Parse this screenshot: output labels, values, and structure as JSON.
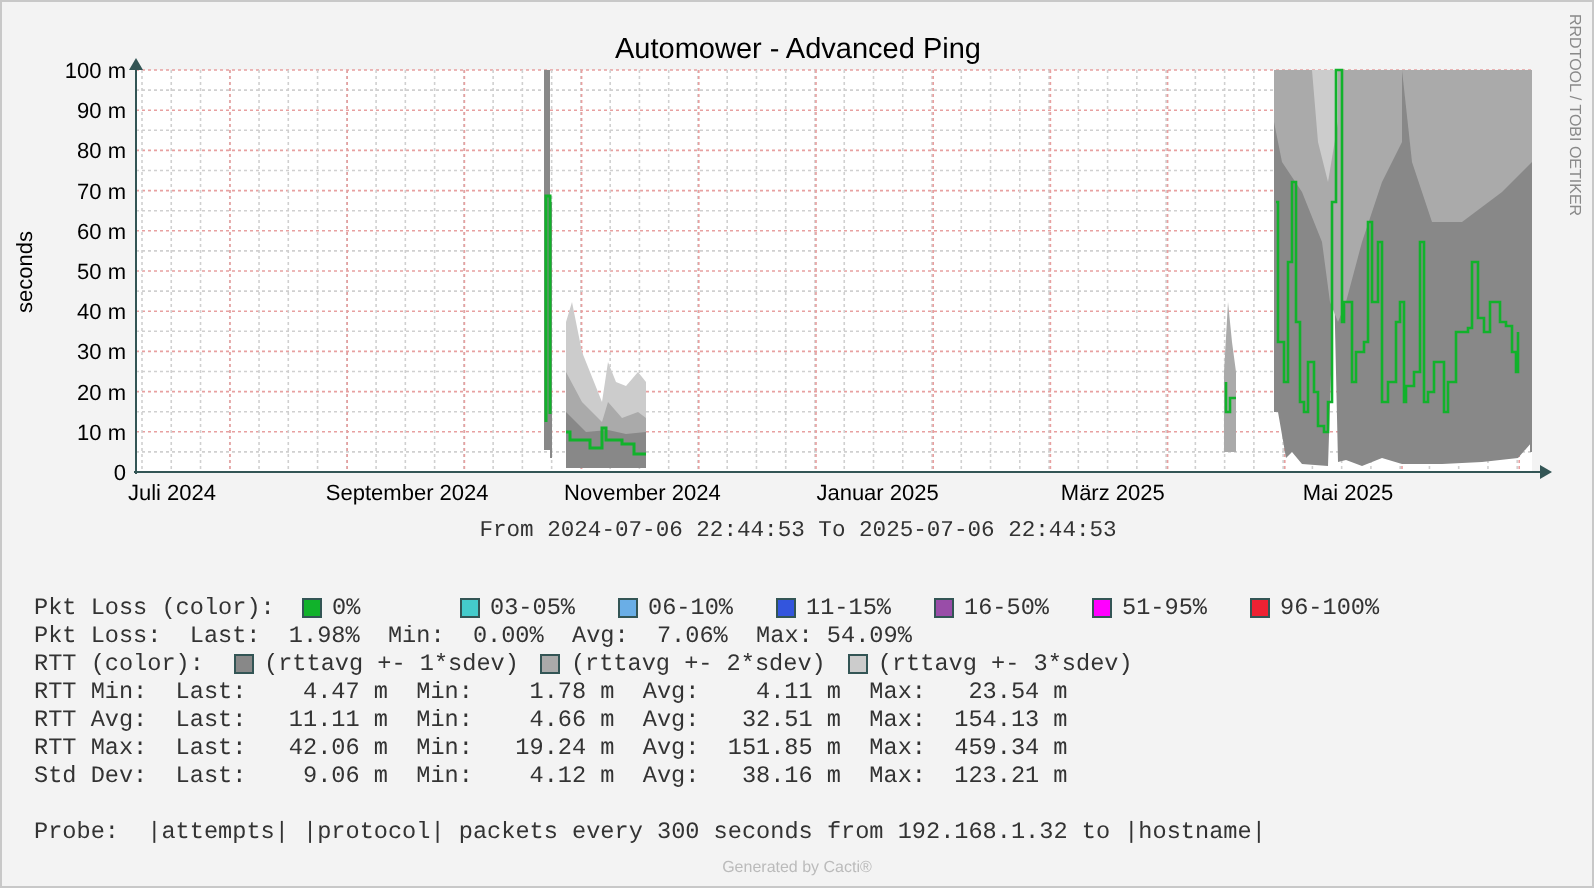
{
  "graph": {
    "title": "Automower - Advanced Ping",
    "ylabel": "seconds",
    "yticks": [
      "100 m",
      "90 m",
      "80 m",
      "70 m",
      "60 m",
      "50 m",
      "40 m",
      "30 m",
      "20 m",
      "10 m",
      "0"
    ],
    "xticks": [
      "Juli 2024",
      "September 2024",
      "November 2024",
      "Januar 2025",
      "März 2025",
      "Mai 2025"
    ],
    "range": "From 2024-07-06 22:44:53 To 2025-07-06 22:44:53",
    "side_text": "RRDTOOL / TOBI OETIKER"
  },
  "loss_legend": {
    "label": "Pkt Loss (color):",
    "items": [
      {
        "label": "0%",
        "color": "#11b22b"
      },
      {
        "label": "03-05%",
        "color": "#44cccc"
      },
      {
        "label": "06-10%",
        "color": "#6aaee6"
      },
      {
        "label": "11-15%",
        "color": "#3355dd"
      },
      {
        "label": "16-50%",
        "color": "#994da8"
      },
      {
        "label": "51-95%",
        "color": "#ff00ff"
      },
      {
        "label": "96-100%",
        "color": "#ee2233"
      }
    ]
  },
  "stats": [
    {
      "kind": "loss",
      "label": "Pkt Loss:",
      "cells": [
        "Last:",
        "1.98%",
        "Min:",
        "0.00%",
        "Avg:",
        "7.06%",
        "Max:",
        "54.09%"
      ]
    }
  ],
  "rtt_legend": {
    "label": "RTT (color):",
    "items": [
      {
        "label": "(rttavg +- 1*sdev)",
        "color": "#888888"
      },
      {
        "label": "(rttavg +- 2*sdev)",
        "color": "#aaaaaa"
      },
      {
        "label": "(rttavg +- 3*sdev)",
        "color": "#cccccc"
      }
    ]
  },
  "rtt_stats": [
    {
      "kind": "rtt",
      "label": "RTT Min:",
      "cells": [
        "Last:",
        "4.47 m",
        "Min:",
        "1.78 m",
        "Avg:",
        "4.11 m",
        "Max:",
        "23.54 m"
      ]
    },
    {
      "kind": "rtt",
      "label": "RTT Avg:",
      "cells": [
        "Last:",
        "11.11 m",
        "Min:",
        "4.66 m",
        "Avg:",
        "32.51 m",
        "Max:",
        "154.13 m"
      ]
    },
    {
      "kind": "rtt",
      "label": "RTT Max:",
      "cells": [
        "Last:",
        "42.06 m",
        "Min:",
        "19.24 m",
        "Avg:",
        "151.85 m",
        "Max:",
        "459.34 m"
      ]
    },
    {
      "kind": "rtt",
      "label": "Std Dev:",
      "cells": [
        "Last:",
        "9.06 m",
        "Min:",
        "4.12 m",
        "Avg:",
        "38.16 m",
        "Max:",
        "123.21 m"
      ]
    }
  ],
  "probe": "Probe:  |attempts| |protocol| packets every 300 seconds from 192.168.1.32 to |hostname|",
  "footer": "Generated by Cacti®"
}
